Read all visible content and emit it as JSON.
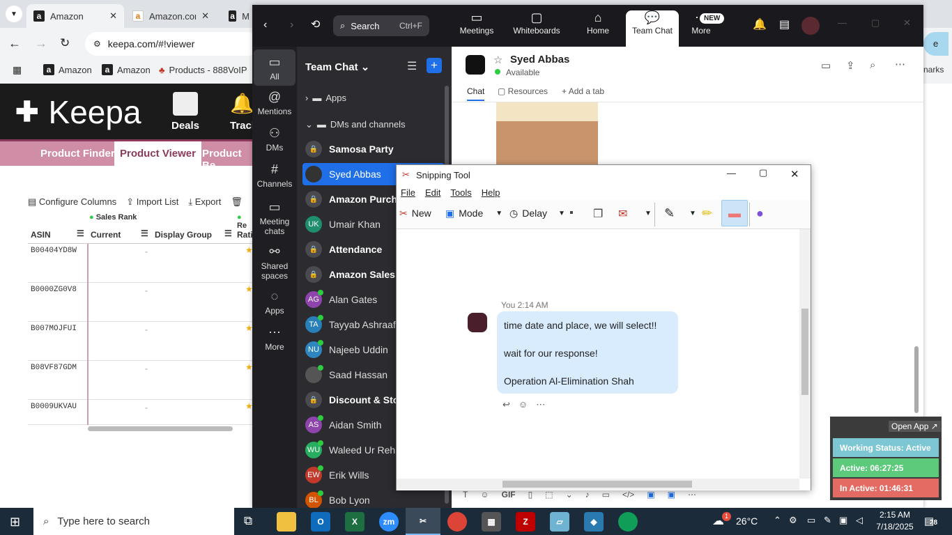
{
  "browser": {
    "tabs": [
      {
        "label": "Amazon"
      },
      {
        "label": "Amazon.com"
      },
      {
        "label": "M"
      }
    ],
    "url": "keepa.com/#!viewer",
    "bookmarks": [
      "Amazon",
      "Amazon",
      "Products - 888VoIP"
    ],
    "bookmarks_right": "narks"
  },
  "keepa": {
    "logo": "Keepa",
    "deals": "Deals",
    "track": "Track",
    "nav": [
      "Product Finder",
      "Product Viewer",
      "Product Be"
    ],
    "toolbar": [
      "Configure Columns",
      "Import List",
      "Export"
    ],
    "group_header": "Sales Rank",
    "group_header2": "Re",
    "columns": [
      "ASIN",
      "Current",
      "Display Group",
      "Rati"
    ],
    "rows": [
      {
        "asin": "B00404YD8W",
        "current": "-"
      },
      {
        "asin": "B0000ZG0V8",
        "current": "-"
      },
      {
        "asin": "B007MOJFUI",
        "current": "-"
      },
      {
        "asin": "B08VF87GDM",
        "current": "-"
      },
      {
        "asin": "B0009UKVAU",
        "current": "-"
      }
    ]
  },
  "teams": {
    "search": "Search",
    "search_shortcut": "Ctrl+F",
    "top_nav": [
      "Meetings",
      "Whiteboards",
      "Home",
      "Team Chat",
      "More"
    ],
    "new_badge": "NEW",
    "rail": [
      "All",
      "Mentions",
      "DMs",
      "Channels",
      "Meeting chats",
      "Shared spaces",
      "Apps",
      "More"
    ],
    "panel_title": "Team Chat",
    "sections": [
      "Apps",
      "DMs and channels"
    ],
    "channels": [
      {
        "name": "Samosa Party",
        "type": "lock",
        "bold": true
      },
      {
        "name": "Syed Abbas",
        "type": "avatar",
        "initials": "",
        "color": "#333333",
        "selected": true
      },
      {
        "name": "Amazon Purch",
        "type": "lock",
        "bold": true
      },
      {
        "name": "Umair Khan",
        "type": "avatar",
        "initials": "UK",
        "color": "#1e8e6e"
      },
      {
        "name": "Attendance",
        "type": "lock",
        "bold": true
      },
      {
        "name": "Amazon Sales",
        "type": "lock",
        "bold": true
      },
      {
        "name": "Alan Gates",
        "type": "avatar",
        "initials": "AG",
        "color": "#8e44ad",
        "online": true
      },
      {
        "name": "Tayyab Ashraaf",
        "type": "avatar",
        "initials": "TA",
        "color": "#2980b9",
        "online": true
      },
      {
        "name": "Najeeb Uddin",
        "type": "avatar",
        "initials": "NU",
        "color": "#2e86c1",
        "online": true
      },
      {
        "name": "Saad Hassan",
        "type": "avatar",
        "initials": "",
        "color": "#555555",
        "online": true
      },
      {
        "name": "Discount & Sto",
        "type": "lock",
        "bold": true
      },
      {
        "name": "Aidan Smith",
        "type": "avatar",
        "initials": "AS",
        "color": "#8e44ad",
        "online": true
      },
      {
        "name": "Waleed Ur Rehm",
        "type": "avatar",
        "initials": "WU",
        "color": "#27ae60",
        "online": true
      },
      {
        "name": "Erik Wills",
        "type": "avatar",
        "initials": "EW",
        "color": "#c0392b",
        "online": true
      },
      {
        "name": "Bob Lyon",
        "type": "avatar",
        "initials": "BL",
        "color": "#d35400",
        "online": true
      }
    ],
    "chat": {
      "name": "Syed Abbas",
      "status": "Available",
      "tabs": [
        "Chat",
        "Resources",
        "Add a tab"
      ],
      "compose_gif": "GIF"
    }
  },
  "snip": {
    "title": "Snipping Tool",
    "menu": [
      "File",
      "Edit",
      "Tools",
      "Help"
    ],
    "new": "New",
    "mode": "Mode",
    "delay": "Delay",
    "message": {
      "meta": "You 2:14 AM",
      "lines": [
        "time date and place, we will select!!",
        "wait for our response!",
        "Operation Al-Elimination Shah"
      ]
    }
  },
  "status_widget": {
    "open_app": "Open App ↗",
    "working": "Working Status: Active",
    "active": "Active: 06:27:25",
    "inactive": "In Active: 01:46:31"
  },
  "taskbar": {
    "search": "Type here to search",
    "weather": "26°C",
    "weather_badge": "1",
    "time": "2:15 AM",
    "date": "7/18/2025",
    "notif": "28"
  }
}
